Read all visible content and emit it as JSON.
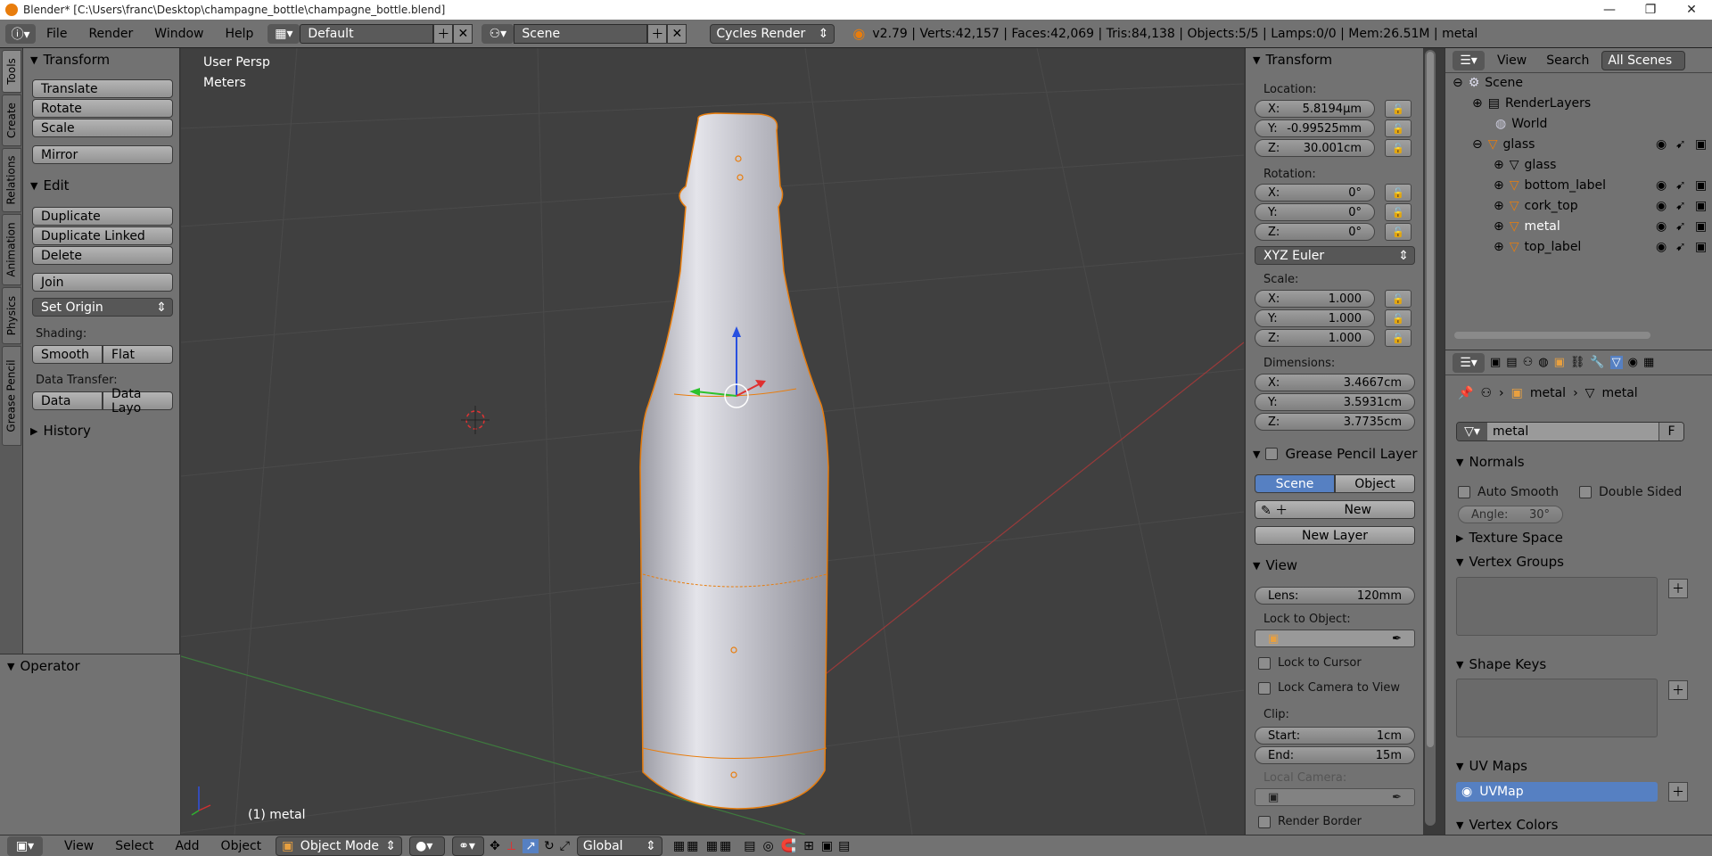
{
  "window": {
    "title": "Blender* [C:\\Users\\franc\\Desktop\\champagne_bottle\\champagne_bottle.blend]"
  },
  "menus": [
    "File",
    "Render",
    "Window",
    "Help"
  ],
  "header": {
    "layout": "Default",
    "scene": "Scene",
    "engine": "Cycles Render",
    "stats": "v2.79 | Verts:42,157 | Faces:42,069 | Tris:84,138 | Objects:5/5 | Lamps:0/0 | Mem:26.51M | metal"
  },
  "left_tabs": [
    "Tools",
    "Create",
    "Relations",
    "Animation",
    "Physics",
    "Grease Pencil"
  ],
  "toolshelf": {
    "transform_title": "Transform",
    "translate": "Translate",
    "rotate": "Rotate",
    "scale": "Scale",
    "mirror": "Mirror",
    "edit_title": "Edit",
    "duplicate": "Duplicate",
    "duplicate_linked": "Duplicate Linked",
    "delete": "Delete",
    "join": "Join",
    "set_origin": "Set Origin",
    "shading_label": "Shading:",
    "smooth": "Smooth",
    "flat": "Flat",
    "data_transfer_label": "Data Transfer:",
    "data": "Data",
    "data_layo": "Data Layo",
    "history": "History",
    "operator": "Operator"
  },
  "viewport": {
    "view_name": "User Persp",
    "units": "Meters",
    "object_label": "(1) metal"
  },
  "nprops": {
    "transform_title": "Transform",
    "location_label": "Location:",
    "loc": [
      {
        "k": "X:",
        "v": "5.8194µm"
      },
      {
        "k": "Y:",
        "v": "-0.99525mm"
      },
      {
        "k": "Z:",
        "v": "30.001cm"
      }
    ],
    "rotation_label": "Rotation:",
    "rot": [
      {
        "k": "X:",
        "v": "0°"
      },
      {
        "k": "Y:",
        "v": "0°"
      },
      {
        "k": "Z:",
        "v": "0°"
      }
    ],
    "rot_mode": "XYZ Euler",
    "scale_label": "Scale:",
    "scl": [
      {
        "k": "X:",
        "v": "1.000"
      },
      {
        "k": "Y:",
        "v": "1.000"
      },
      {
        "k": "Z:",
        "v": "1.000"
      }
    ],
    "dimensions_label": "Dimensions:",
    "dim": [
      {
        "k": "X:",
        "v": "3.4667cm"
      },
      {
        "k": "Y:",
        "v": "3.5931cm"
      },
      {
        "k": "Z:",
        "v": "3.7735cm"
      }
    ],
    "gp_title": "Grease Pencil Layer",
    "gp_scene": "Scene",
    "gp_object": "Object",
    "gp_new": "New",
    "gp_new_layer": "New Layer",
    "view_title": "View",
    "lens_label": "Lens:",
    "lens_value": "120mm",
    "lock_object_label": "Lock to Object:",
    "lock_cursor": "Lock to Cursor",
    "lock_camera": "Lock Camera to View",
    "clip_label": "Clip:",
    "clip_start_k": "Start:",
    "clip_start_v": "1cm",
    "clip_end_k": "End:",
    "clip_end_v": "15m",
    "local_camera": "Local Camera:",
    "render_border": "Render Border"
  },
  "outliner": {
    "view": "View",
    "search": "Search",
    "all_scenes": "All Scenes",
    "rows": [
      {
        "label": "Scene",
        "indent": 0
      },
      {
        "label": "RenderLayers",
        "indent": 1
      },
      {
        "label": "World",
        "indent": 1
      },
      {
        "label": "glass",
        "indent": 1
      },
      {
        "label": "glass",
        "indent": 2
      },
      {
        "label": "bottom_label",
        "indent": 2
      },
      {
        "label": "cork_top",
        "indent": 2
      },
      {
        "label": "metal",
        "indent": 2
      },
      {
        "label": "top_label",
        "indent": 2
      }
    ]
  },
  "properties": {
    "breadcrumb_obj": "metal",
    "breadcrumb_mesh": "metal",
    "mesh_name": "metal",
    "fake_user": "F",
    "normals_title": "Normals",
    "auto_smooth": "Auto Smooth",
    "double_sided": "Double Sided",
    "angle_k": "Angle:",
    "angle_v": "30°",
    "texture_space": "Texture Space",
    "vertex_groups": "Vertex Groups",
    "shape_keys": "Shape Keys",
    "uv_maps": "UV Maps",
    "uvmap_name": "UVMap",
    "vertex_colors": "Vertex Colors"
  },
  "bottom": {
    "view": "View",
    "select": "Select",
    "add": "Add",
    "object": "Object",
    "mode": "Object Mode",
    "orientation": "Global"
  },
  "colors": {
    "accent_selection": "#5680c2",
    "object_orange": "#e87d0d"
  }
}
